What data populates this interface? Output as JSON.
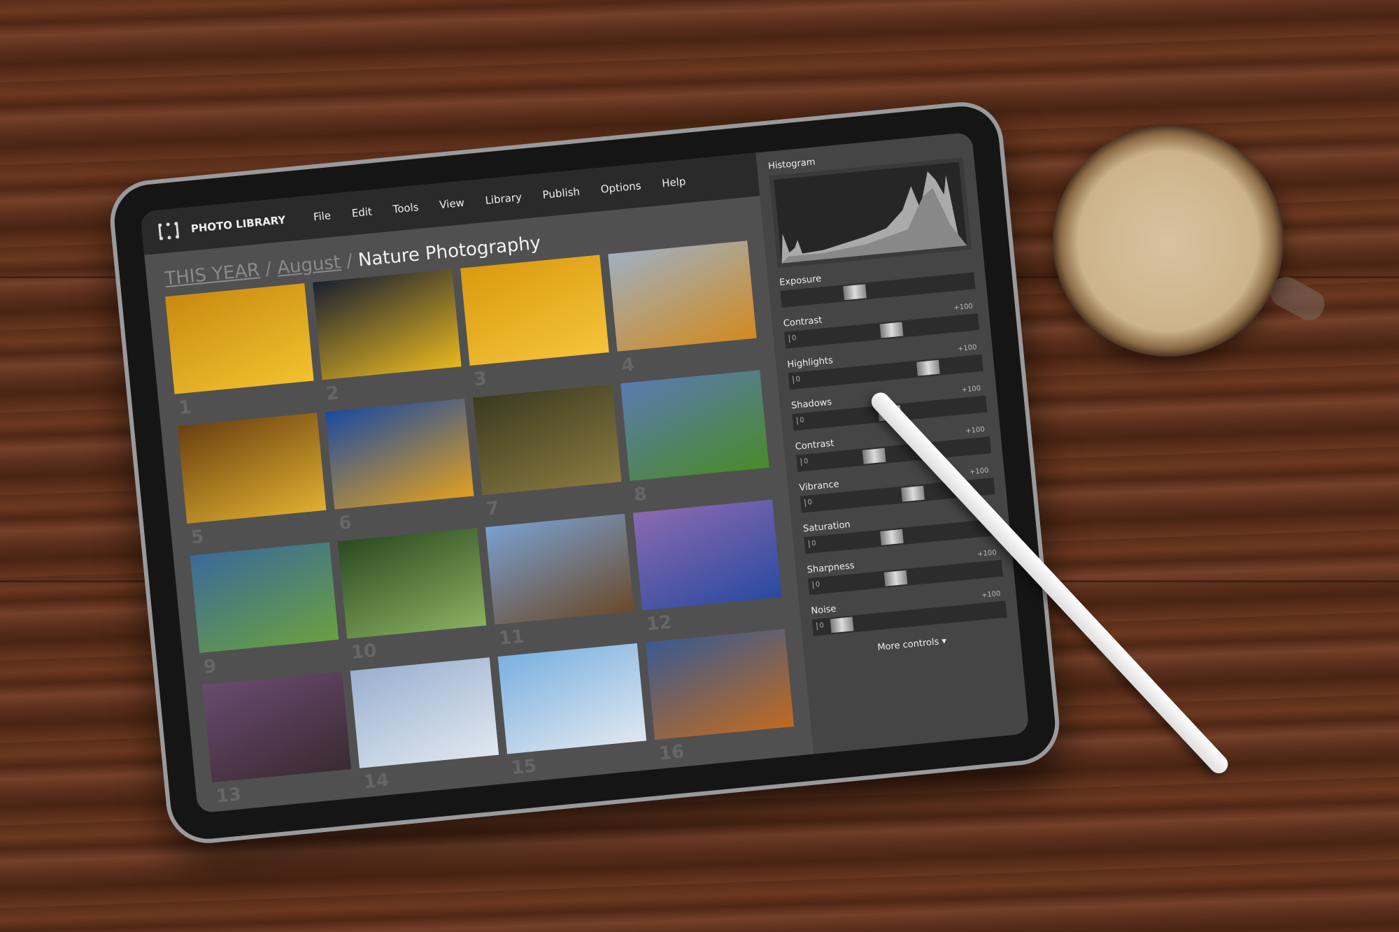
{
  "app": {
    "title": "PHOTO LIBRARY",
    "icon": "film-icon"
  },
  "menu": [
    "File",
    "Edit",
    "Tools",
    "View",
    "Library",
    "Publish",
    "Options",
    "Help"
  ],
  "breadcrumb": {
    "items": [
      "THIS YEAR",
      "August"
    ],
    "current": "Nature Photography",
    "separator": "/"
  },
  "photos": [
    {
      "n": "1",
      "c": "#c98a10,#f2c230"
    },
    {
      "n": "2",
      "c": "#1a2030,#e8b820"
    },
    {
      "n": "3",
      "c": "#d99a10,#f6c43a"
    },
    {
      "n": "4",
      "c": "#9fb0c0,#d28a20"
    },
    {
      "n": "5",
      "c": "#6a4010,#e0b030"
    },
    {
      "n": "6",
      "c": "#1a4aa0,#e0a020"
    },
    {
      "n": "7",
      "c": "#3a3a20,#8a7a40"
    },
    {
      "n": "8",
      "c": "#5a7ab0,#4a8a2a"
    },
    {
      "n": "9",
      "c": "#3a6a9a,#6aa040"
    },
    {
      "n": "10",
      "c": "#2a4a20,#8ab060"
    },
    {
      "n": "11",
      "c": "#7aa0d0,#6a4a2a"
    },
    {
      "n": "12",
      "c": "#8a6ab0,#2a4aa0"
    },
    {
      "n": "13",
      "c": "#6a4a70,#3a2a30"
    },
    {
      "n": "14",
      "c": "#9ab0d0,#e0e8f0"
    },
    {
      "n": "15",
      "c": "#7ab0e0,#e0e8f0"
    },
    {
      "n": "16",
      "c": "#3a5a90,#c06a20"
    }
  ],
  "panel": {
    "histogram_label": "Histogram",
    "controls": [
      {
        "label": "Exposure",
        "value": 0.38,
        "min": "",
        "max": ""
      },
      {
        "label": "Contrast",
        "value": 0.55,
        "min": "0",
        "max": "+100"
      },
      {
        "label": "Highlights",
        "value": 0.72,
        "min": "0",
        "max": "+100"
      },
      {
        "label": "Shadows",
        "value": 0.5,
        "min": "0",
        "max": "+100"
      },
      {
        "label": "Contrast",
        "value": 0.4,
        "min": "0",
        "max": "+100"
      },
      {
        "label": "Vibrance",
        "value": 0.58,
        "min": "0",
        "max": "+100"
      },
      {
        "label": "Saturation",
        "value": 0.45,
        "min": "0",
        "max": "+100"
      },
      {
        "label": "Sharpness",
        "value": 0.45,
        "min": "0",
        "max": "+100"
      },
      {
        "label": "Noise",
        "value": 0.15,
        "min": "0",
        "max": "+100"
      }
    ],
    "more_label": "More controls",
    "more_icon": "caret-down-icon"
  }
}
